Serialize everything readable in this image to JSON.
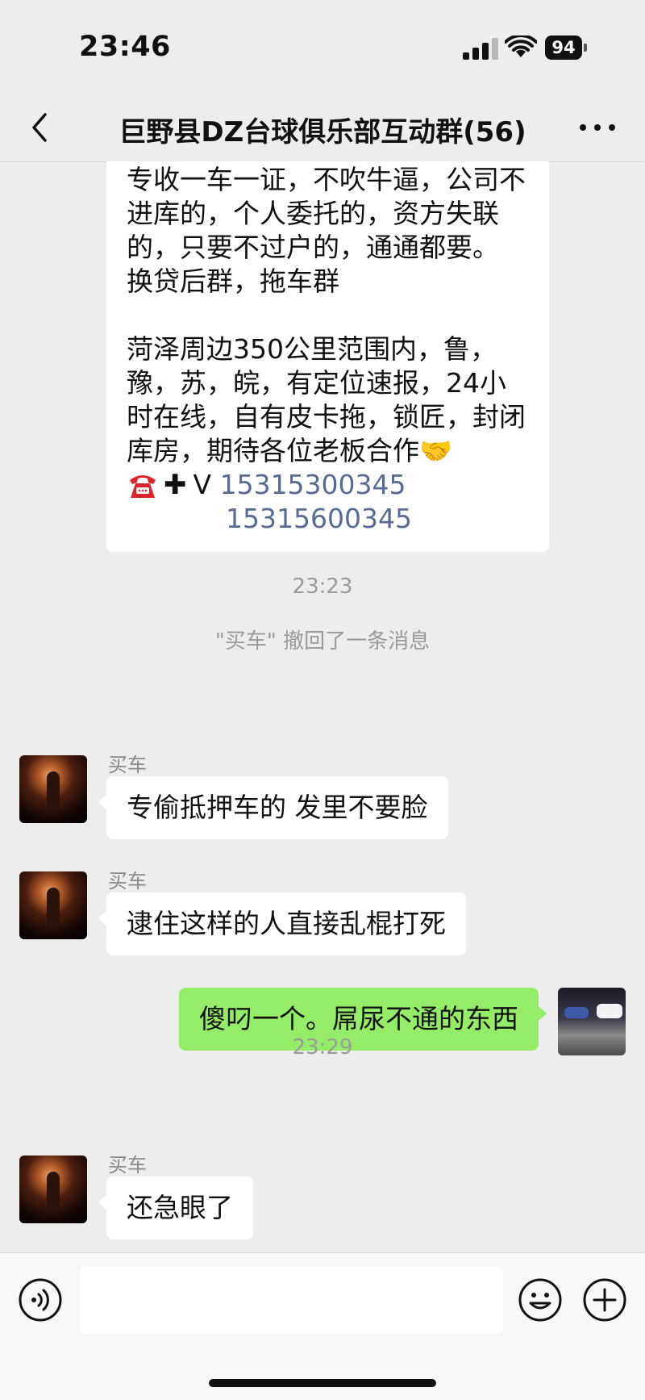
{
  "status_bar": {
    "time": "23:46",
    "battery": "94"
  },
  "header": {
    "title": "巨野县DZ台球俱乐部互动群(56)"
  },
  "messages": {
    "ad": {
      "line1": "专收一车一证，不吹牛逼，公司不进库的，个人委托的，资方失联的，只要不过户的，通通都要。",
      "line2": "换贷后群，拖车群",
      "line3": "菏泽周边350公里范围内，鲁，豫，苏，皖，有定位速报，24小时在线，自有皮卡拖，锁匠，封闭库房，期待各位老板合作🤝",
      "contact_prefix": "V",
      "phone1": "15315300345",
      "phone2": "15315600345"
    },
    "time1": "23:23",
    "recall_notice": "\"买车\" 撤回了一条消息",
    "msg1": {
      "sender": "买车",
      "text": "专偷抵押车的 发里不要脸"
    },
    "msg2": {
      "sender": "买车",
      "text": "逮住这样的人直接乱棍打死"
    },
    "msg3": {
      "text": "傻叼一个。屌尿不通的东西"
    },
    "time2": "23:29",
    "msg4": {
      "sender": "买车",
      "text": "还急眼了"
    }
  },
  "colors": {
    "my_bubble": "#95ec69",
    "link": "#576b95",
    "background": "#ededed"
  },
  "icons": [
    "back-icon",
    "more-icon",
    "voice-icon",
    "emoji-icon",
    "plus-icon",
    "telephone-icon",
    "signal-icon",
    "wifi-icon",
    "battery-icon"
  ]
}
